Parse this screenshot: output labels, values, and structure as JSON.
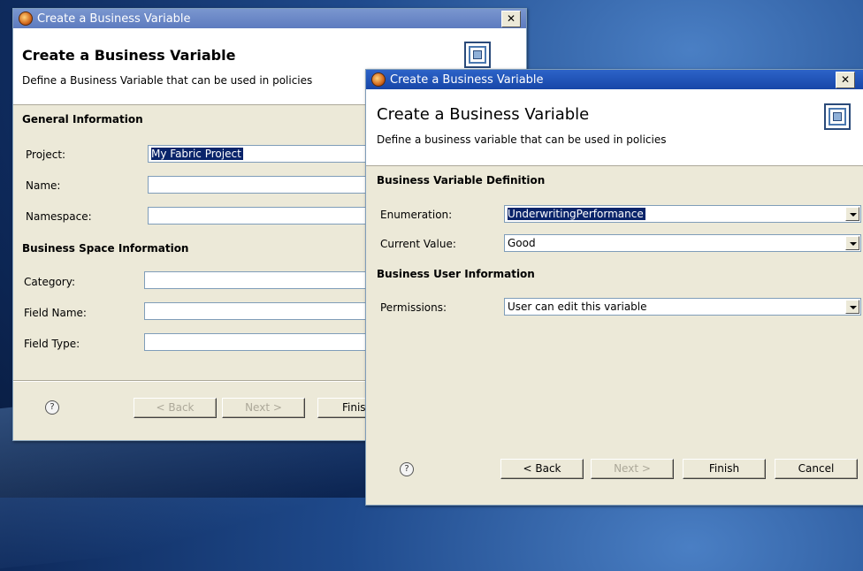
{
  "back_dialog": {
    "title": "Create a Business Variable",
    "close": "✕",
    "header_title": "Create a Business Variable",
    "header_desc": "Define a Business Variable that can be used in policies",
    "section_general": "General Information",
    "project_label": "Project:",
    "project_value": "My Fabric Project",
    "name_label": "Name:",
    "name_value": "",
    "namespace_label": "Namespace:",
    "namespace_value": "",
    "section_space": "Business Space Information",
    "category_label": "Category:",
    "category_value": "",
    "field_name_label": "Field Name:",
    "field_name_value": "",
    "field_type_label": "Field Type:",
    "field_type_value": "",
    "help": "?",
    "back_btn": "< Back",
    "next_btn": "Next >",
    "finish_btn": "Finis"
  },
  "front_dialog": {
    "title": "Create a Business Variable",
    "close": "✕",
    "header_title": "Create a Business Variable",
    "header_desc": "Define a business variable that can be used in policies",
    "section_definition": "Business Variable Definition",
    "enumeration_label": "Enumeration:",
    "enumeration_value": "UnderwritingPerformance",
    "current_value_label": "Current Value:",
    "current_value_value": "Good",
    "section_user": "Business User Information",
    "permissions_label": "Permissions:",
    "permissions_value": "User can edit this variable",
    "help": "?",
    "back_btn": "< Back",
    "next_btn": "Next >",
    "finish_btn": "Finish",
    "cancel_btn": "Cancel"
  }
}
